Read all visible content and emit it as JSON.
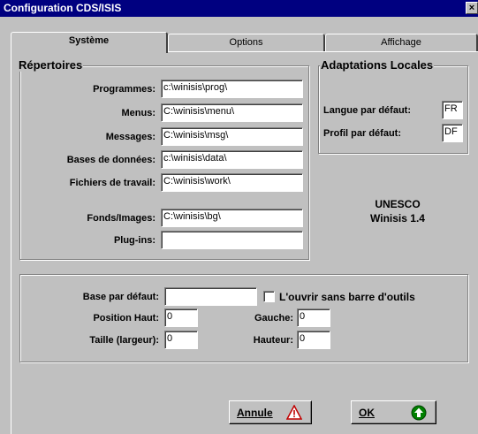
{
  "window": {
    "title": "Configuration CDS/ISIS",
    "close_label": "×"
  },
  "tabs": [
    {
      "label": "Système",
      "active": true
    },
    {
      "label": "Options",
      "active": false
    },
    {
      "label": "Affichage",
      "active": false
    }
  ],
  "repertoires": {
    "title": "Répertoires",
    "rows": [
      {
        "label": "Programmes:",
        "value": "c:\\winisis\\prog\\"
      },
      {
        "label": "Menus:",
        "value": "C:\\winisis\\menu\\"
      },
      {
        "label": "Messages:",
        "value": "C:\\winisis\\msg\\"
      },
      {
        "label": "Bases de données:",
        "value": "c:\\winisis\\data\\"
      },
      {
        "label": "Fichiers de travail:",
        "value": "C:\\winisis\\work\\"
      },
      {
        "label": "Fonds/Images:",
        "value": "C:\\winisis\\bg\\"
      },
      {
        "label": "Plug-ins:",
        "value": ""
      }
    ]
  },
  "adaptations": {
    "title": "Adaptations Locales",
    "langue_label": "Langue par défaut:",
    "langue_value": "FR",
    "profil_label": "Profil par défaut:",
    "profil_value": "DF"
  },
  "info": {
    "org": "UNESCO",
    "version": "Winisis 1.4"
  },
  "defaults": {
    "base_label": "Base par défaut:",
    "base_value": "",
    "checkbox_label": "L'ouvrir sans barre d'outils",
    "checkbox_checked": false,
    "position_haut_label": "Position Haut:",
    "position_haut_value": "0",
    "gauche_label": "Gauche:",
    "gauche_value": "0",
    "taille_label": "Taille (largeur):",
    "taille_value": "0",
    "hauteur_label": "Hauteur:",
    "hauteur_value": "0"
  },
  "buttons": {
    "annule_label": "Annule",
    "ok_label": "OK",
    "warning_icon": "warning-triangle-icon",
    "ok_icon": "green-arrow-up-icon"
  },
  "colors": {
    "titlebar": "#000080",
    "face": "#c0c0c0",
    "warning": "#c00000",
    "ok_green": "#008000"
  }
}
